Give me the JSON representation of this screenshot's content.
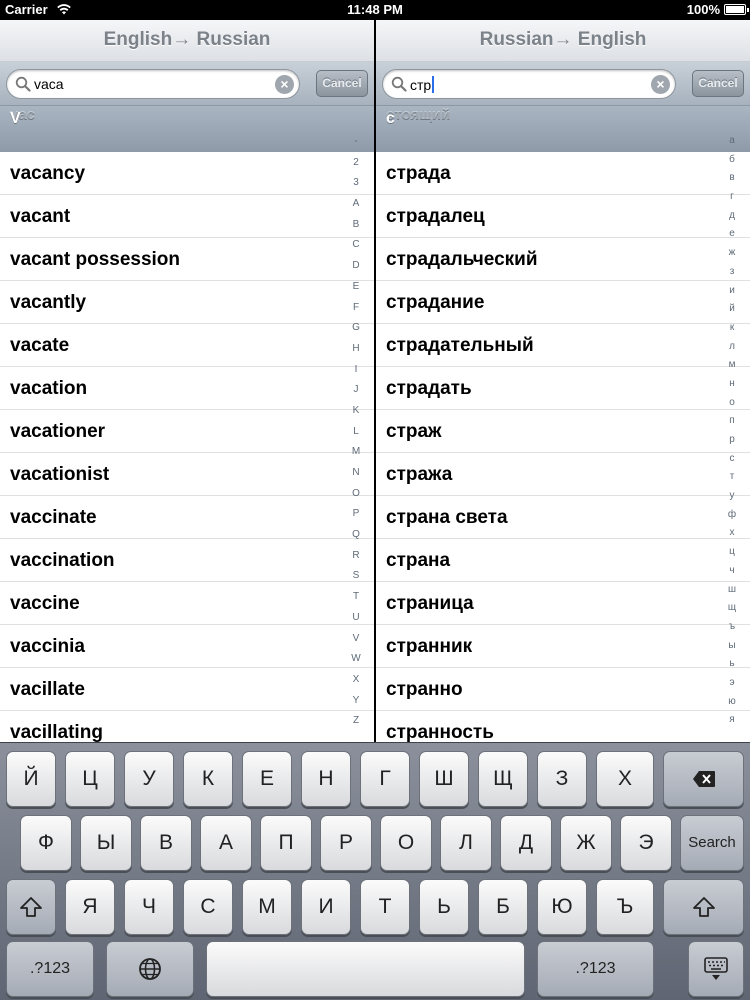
{
  "status": {
    "carrier": "Carrier",
    "time": "11:48 PM",
    "battery": "100%"
  },
  "left": {
    "title": "English→ Russian",
    "search_value": "vaca",
    "cancel_label": "Cancel",
    "ghost_header": "vac",
    "section_letter": "V",
    "rows": [
      "vacancy",
      "vacant",
      "vacant possession",
      "vacantly",
      "vacate",
      "vacation",
      "vacationer",
      "vacationist",
      "vaccinate",
      "vaccination",
      "vaccine",
      "vaccinia",
      "vacillate",
      "vacillating"
    ],
    "index": [
      "-",
      "2",
      "3",
      "A",
      "B",
      "C",
      "D",
      "E",
      "F",
      "G",
      "H",
      "I",
      "J",
      "K",
      "L",
      "M",
      "N",
      "O",
      "P",
      "Q",
      "R",
      "S",
      "T",
      "U",
      "V",
      "W",
      "X",
      "Y",
      "Z"
    ]
  },
  "right": {
    "title": "Russian→ English",
    "search_value": "стр",
    "cancel_label": "Cancel",
    "ghost_header": "стоящий",
    "section_letter": "с",
    "rows": [
      "страда",
      "страдалец",
      "страдальческий",
      "страдание",
      "страдательный",
      "страдать",
      "страж",
      "стража",
      "страна света",
      "страна",
      "страница",
      "странник",
      "странно",
      "странность"
    ],
    "index": [
      "а",
      "б",
      "в",
      "г",
      "д",
      "е",
      "ж",
      "з",
      "и",
      "й",
      "к",
      "л",
      "м",
      "н",
      "о",
      "п",
      "р",
      "с",
      "т",
      "у",
      "ф",
      "х",
      "ц",
      "ч",
      "ш",
      "щ",
      "ъ",
      "ы",
      "ь",
      "э",
      "ю",
      "я"
    ]
  },
  "keyboard": {
    "row1": [
      "Й",
      "Ц",
      "У",
      "К",
      "Е",
      "Н",
      "Г",
      "Ш",
      "Щ",
      "З",
      "Х"
    ],
    "row2": [
      "Ф",
      "Ы",
      "В",
      "А",
      "П",
      "Р",
      "О",
      "Л",
      "Д",
      "Ж",
      "Э"
    ],
    "row3": [
      "Я",
      "Ч",
      "С",
      "М",
      "И",
      "Т",
      "Ь",
      "Б",
      "Ю",
      "Ъ"
    ],
    "search_label": "Search",
    "numbers_label": ".?123"
  }
}
